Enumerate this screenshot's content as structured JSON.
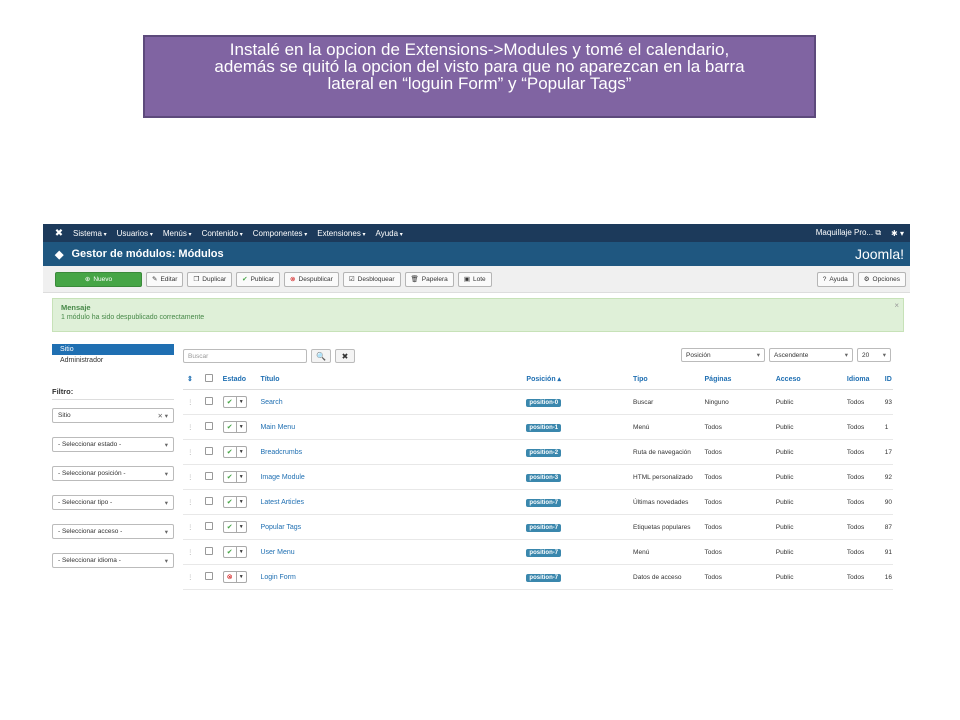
{
  "caption": {
    "line1": "Instalé en la opcion de Extensions->Modules y tomé el calendario,",
    "line2": "además se quitó la opcion del visto para que no aparezcan en la barra",
    "line3": "lateral en “loguin Form” y “Popular Tags”"
  },
  "topnav": {
    "items": [
      "Sistema",
      "Usuarios",
      "Menús",
      "Contenido",
      "Componentes",
      "Extensiones",
      "Ayuda"
    ],
    "site_link": "Maquillaje Pro...",
    "gear": "✱"
  },
  "header": {
    "title": "Gestor de módulos: Módulos",
    "brand": "Joomla!"
  },
  "toolbar": {
    "new": "Nuevo",
    "edit": "Editar",
    "duplicate": "Duplicar",
    "publish": "Publicar",
    "unpublish": "Despublicar",
    "checkin": "Desbloquear",
    "trash": "Papelera",
    "batch": "Lote",
    "help": "Ayuda",
    "options": "Opciones"
  },
  "message": {
    "heading": "Mensaje",
    "text": "1 módulo ha sido despublicado correctamente",
    "close": "×"
  },
  "sidebar": {
    "site": "Sitio",
    "admin": "Administrador",
    "filter_label": "Filtro:",
    "filters": [
      "Sitio",
      "- Seleccionar estado -",
      "- Seleccionar posición -",
      "- Seleccionar tipo -",
      "- Seleccionar acceso -",
      "- Seleccionar idioma -"
    ]
  },
  "search": {
    "placeholder": "Buscar",
    "sort_field": "Posición",
    "sort_dir": "Ascendente",
    "limit": "20"
  },
  "table": {
    "headers": {
      "status": "Estado",
      "title": "Título",
      "position": "Posición",
      "type": "Tipo",
      "pages": "Páginas",
      "access": "Acceso",
      "language": "Idioma",
      "id": "ID"
    },
    "rows": [
      {
        "title": "Search",
        "position": "position-0",
        "type": "Buscar",
        "pages": "Ninguno",
        "access": "Public",
        "language": "Todos",
        "id": "93",
        "published": true
      },
      {
        "title": "Main Menu",
        "position": "position-1",
        "type": "Menú",
        "pages": "Todos",
        "access": "Public",
        "language": "Todos",
        "id": "1",
        "published": true
      },
      {
        "title": "Breadcrumbs",
        "position": "position-2",
        "type": "Ruta de navegación",
        "pages": "Todos",
        "access": "Public",
        "language": "Todos",
        "id": "17",
        "published": true
      },
      {
        "title": "Image Module",
        "position": "position-3",
        "type": "HTML personalizado",
        "pages": "Todos",
        "access": "Public",
        "language": "Todos",
        "id": "92",
        "published": true
      },
      {
        "title": "Latest Articles",
        "position": "position-7",
        "type": "Últimas novedades",
        "pages": "Todos",
        "access": "Public",
        "language": "Todos",
        "id": "90",
        "published": true
      },
      {
        "title": "Popular Tags",
        "position": "position-7",
        "type": "Etiquetas populares",
        "pages": "Todos",
        "access": "Public",
        "language": "Todos",
        "id": "87",
        "published": true
      },
      {
        "title": "User Menu",
        "position": "position-7",
        "type": "Menú",
        "pages": "Todos",
        "access": "Public",
        "language": "Todos",
        "id": "91",
        "published": true
      },
      {
        "title": "Login Form",
        "position": "position-7",
        "type": "Datos de acceso",
        "pages": "Todos",
        "access": "Public",
        "language": "Todos",
        "id": "16",
        "published": false
      }
    ]
  }
}
